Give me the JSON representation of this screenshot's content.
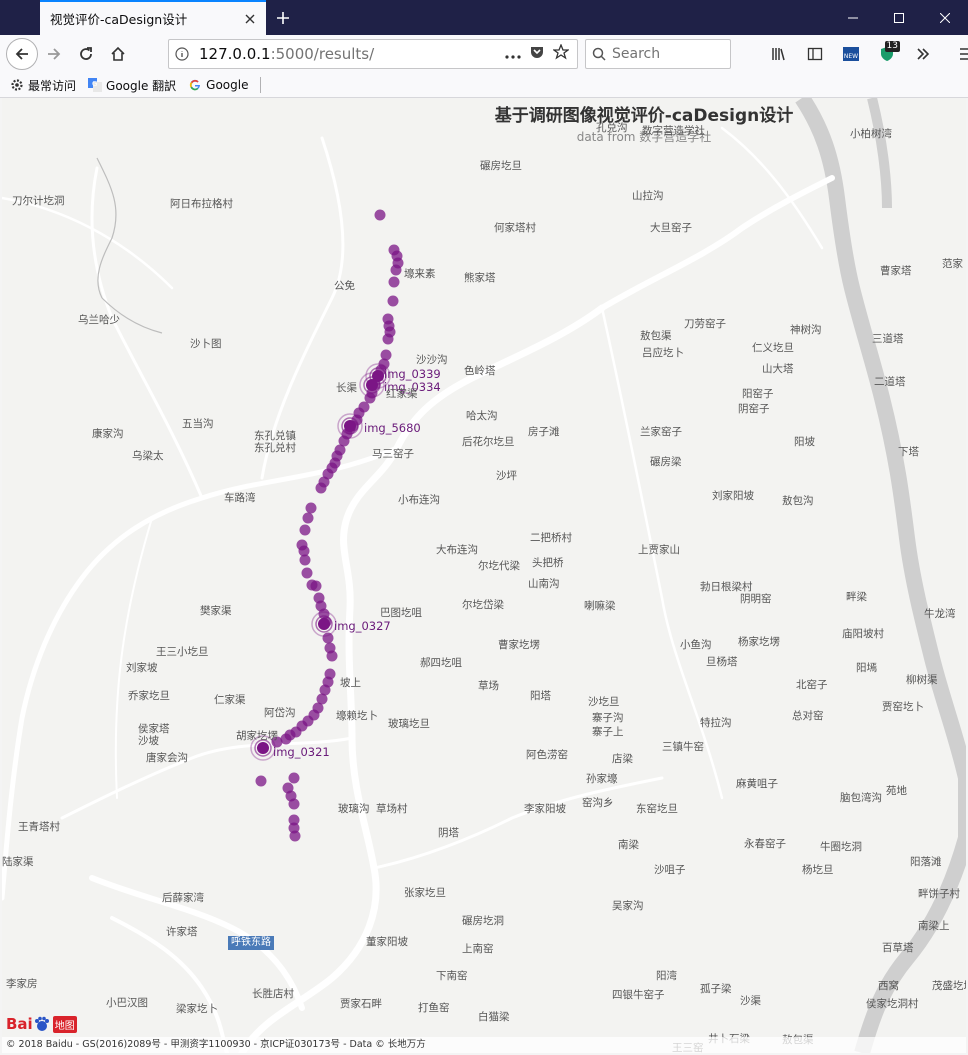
{
  "browser": {
    "tab_title": "视觉评价-caDesign设计",
    "url_host": "127.0.0.1",
    "url_path": ":5000/results/",
    "search_placeholder": "Search",
    "ext_badge": "13",
    "bookmarks": [
      {
        "label": "最常访问",
        "icon": "gear-icon"
      },
      {
        "label": "Google 翻訳",
        "icon": "google-translate-icon"
      },
      {
        "label": "Google",
        "icon": "google-icon"
      }
    ]
  },
  "map": {
    "title": "基于调研图像视觉评价-caDesign设计",
    "subtitle": "data from 数字营造学社",
    "road_sign": "呼铁东路",
    "footer": "© 2018 Baidu - GS(2016)2089号 - 甲测资字1100930 - 京ICP证030173号 - Data © 长地万方",
    "logo_text": "Bai",
    "logo_suffix": "地图",
    "colors": {
      "point": "#7b1585",
      "road": "#ffffff",
      "river": "#cfcfcf"
    },
    "highlighted_points": [
      "img_0339",
      "img_0334",
      "img_5680",
      "img_0327",
      "img_0321"
    ],
    "place_names": [
      "碾房圪旦",
      "孔兑沟",
      "数字营造学社",
      "小柏树湾",
      "山拉沟",
      "刀尔计圪洞",
      "阿日布拉格村",
      "何家塔村",
      "大旦窑子",
      "公免",
      "壕来素",
      "熊家塔",
      "曹家塔",
      "范家",
      "乌兰哈少",
      "沙卜图",
      "敖包渠",
      "刀劳窑子",
      "神树沟",
      "三道塔",
      "仁义圪旦",
      "吕应圪卜",
      "沙沙沟",
      "色岭塔",
      "山大塔",
      "二道塔",
      "长渠",
      "红家渠",
      "阳窑子",
      "阴窑子",
      "五当沟",
      "哈太沟",
      "房子滩",
      "兰家窑子",
      "康家沟",
      "东孔兑镇",
      "东孔兑村",
      "后花尔圪旦",
      "马三窑子",
      "阳坡",
      "下塔",
      "乌梁太",
      "碾房梁",
      "沙坪",
      "车路湾",
      "小布连沟",
      "刘家阳坡",
      "敖包沟",
      "二把桥村",
      "大布连沟",
      "尔圪代梁",
      "头把桥",
      "上贾家山",
      "山南沟",
      "勃日根梁村",
      "阴明窑",
      "畔梁",
      "樊家渠",
      "尔圪岱梁",
      "巴图圪咀",
      "喇嘛梁",
      "牛龙湾",
      "曹家圪塄",
      "小鱼沟",
      "杨家圪塄",
      "庙阳坡村",
      "王三小圪旦",
      "郝四圪咀",
      "旦杨塔",
      "刘家坡",
      "坡上",
      "阳墕",
      "柳树渠",
      "乔家圪旦",
      "草场",
      "阳塔",
      "北窑子",
      "仁家渠",
      "阿岱沟",
      "壕赖圪卜",
      "沙圪旦",
      "寨子沟",
      "特拉沟",
      "总对窑",
      "贾窑圪卜",
      "侯家塔",
      "沙坡",
      "胡家圪塄",
      "玻璃圪旦",
      "寨子上",
      "三镇牛窑",
      "唐家会沟",
      "阿色涝窑",
      "店梁",
      "孙家壕",
      "麻黄咀子",
      "苑地",
      "脑包湾沟",
      "玻璃沟",
      "草场村",
      "窑沟乡",
      "东窑圪旦",
      "王青塔村",
      "李家阳坡",
      "阴塔",
      "南梁",
      "永春窑子",
      "牛圈圪洞",
      "沙咀子",
      "杨圪旦",
      "阳落滩",
      "陆家渠",
      "后薛家湾",
      "张家圪旦",
      "吴家沟",
      "畔饼子村",
      "许家塔",
      "碾房圪洞",
      "南梁上",
      "董家阳坡",
      "上南窑",
      "百草塔",
      "李家房",
      "下南窑",
      "阳湾",
      "孤子梁",
      "西窝",
      "茂盛圪塔",
      "小巴汉图",
      "梁家圪卜",
      "长胜店村",
      "贾家石畔",
      "打鱼窑",
      "四银牛窑子",
      "沙渠",
      "侯家圪洞村",
      "白猫梁",
      "井卜石梁",
      "敖包渠",
      "王三窑"
    ]
  }
}
